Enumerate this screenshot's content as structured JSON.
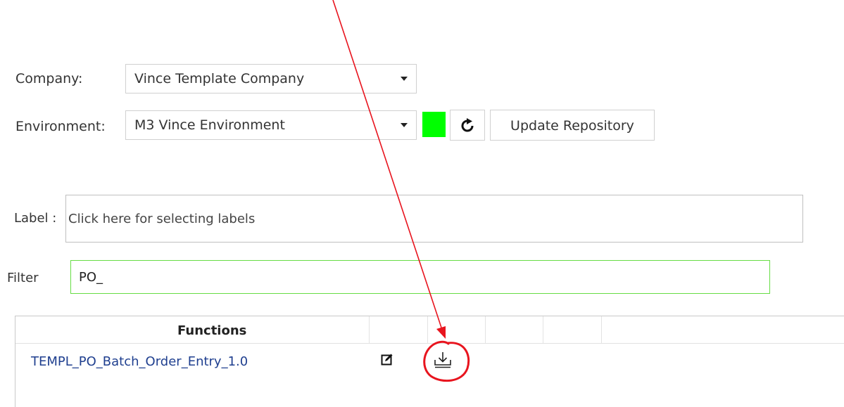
{
  "company": {
    "label": "Company:",
    "value": "Vince Template Company"
  },
  "environment": {
    "label": "Environment:",
    "value": "M3 Vince Environment",
    "status_color": "#00ff00",
    "refresh_icon": "refresh-icon",
    "update_label": "Update Repository"
  },
  "label_filter": {
    "label": "Label :",
    "placeholder": "Click here for selecting labels"
  },
  "filter": {
    "label": "Filter",
    "value": "PO_"
  },
  "table": {
    "header": "Functions",
    "rows": [
      {
        "name": "TEMPL_PO_Batch_Order_Entry_1.0",
        "edit_icon": "edit-icon",
        "download_icon": "download-icon"
      }
    ]
  },
  "annotation": {
    "arrow_color": "#e8141e",
    "circle_color": "#e8141e"
  }
}
